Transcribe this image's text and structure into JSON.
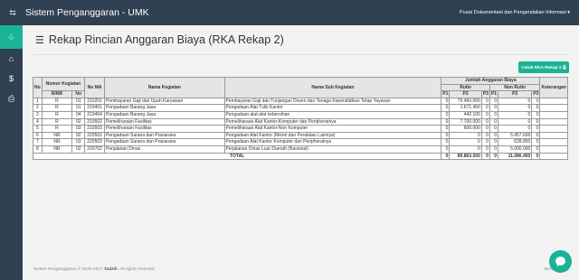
{
  "topbar": {
    "toggle_icon": "⇆",
    "brand": "Sistem Penganggaran - UMK",
    "user": "Pusat Dokumentasi dan Pengendalian Informasi ▾"
  },
  "sidebar": {
    "items": [
      {
        "icon": "palm-icon",
        "glyph": "♧",
        "active": true
      },
      {
        "icon": "home-icon",
        "glyph": "⌂",
        "active": false
      },
      {
        "icon": "dollar-icon",
        "glyph": "$",
        "active": false
      },
      {
        "icon": "print-icon",
        "glyph": "⎙",
        "active": false
      }
    ]
  },
  "page": {
    "title": "Rekap Rincian Anggaran Biaya (RKA Rekap 2)",
    "title_icon": "☰",
    "print_button": "Cetak RKA Rekap 2 ⎙"
  },
  "table": {
    "headers": {
      "no": "No",
      "nomor_kegiatan": "Nomor Kegiatan",
      "rnr": "R/NR",
      "no_sub": "No",
      "no_ma": "No MA",
      "nama_kegiatan": "Nama Kegiatan",
      "nama_sub": "Nama Sub Kegiatan",
      "jumlah": "Jumlah Anggaran Biaya",
      "rutin": "Rutin",
      "non_rutin": "Non Rutin",
      "p1": "P1",
      "p2": "P2",
      "p3": "P3",
      "np1": "P1",
      "np2": "P2",
      "np3": "P3",
      "keterangan": "Keterangan"
    },
    "rows": [
      {
        "no": "1",
        "rnr": "R",
        "sub": "01",
        "ma": "210201",
        "kegiatan": "Pembayaran Gaji dan Upah Karyawan",
        "sub_kegiatan": "Pembayaran Gaji dan Tunjangan Dosen dan Tenaga Kependidikan Tetap Yayasan",
        "p1": "0",
        "p2": "79.450.000",
        "p3": "0",
        "np1": "0",
        "np2": "0",
        "np3": "0",
        "ket": ""
      },
      {
        "no": "2",
        "rnr": "R",
        "sub": "01",
        "ma": "210401",
        "kegiatan": "Pengadaan Barang Jasa",
        "sub_kegiatan": "Pengadaan Alat Tulis Kantor",
        "p1": "0",
        "p2": "1.671.450",
        "p3": "0",
        "np1": "0",
        "np2": "0",
        "np3": "0",
        "ket": ""
      },
      {
        "no": "3",
        "rnr": "R",
        "sub": "04",
        "ma": "210404",
        "kegiatan": "Pengadaan Barang Jasa",
        "sub_kegiatan": "Pengadaan alat-alat kebersihan",
        "p1": "0",
        "p2": "442.100",
        "p3": "0",
        "np1": "0",
        "np2": "0",
        "np3": "0",
        "ket": ""
      },
      {
        "no": "4",
        "rnr": "R",
        "sub": "02",
        "ma": "210502",
        "kegiatan": "Pemeliharaan Fasilitas",
        "sub_kegiatan": "Pemeliharaan Alat Kantor-Komputer dan Peripheralnya",
        "p1": "0",
        "p2": "7.700.000",
        "p3": "0",
        "np1": "0",
        "np2": "0",
        "np3": "0",
        "ket": ""
      },
      {
        "no": "5",
        "rnr": "R",
        "sub": "03",
        "ma": "210503",
        "kegiatan": "Pemeliharaan Fasilitas",
        "sub_kegiatan": "Pemeliharaan Alat Kantor-Non Komputer",
        "p1": "0",
        "p2": "600.000",
        "p3": "0",
        "np1": "0",
        "np2": "0",
        "np3": "0",
        "ket": ""
      },
      {
        "no": "6",
        "rnr": "NR",
        "sub": "02",
        "ma": "220502",
        "kegiatan": "Pengadaan Sarana dan Prasarana",
        "sub_kegiatan": "Pengadaan Alat Kantor (Mesin dan Peralatan Lainnya)",
        "p1": "0",
        "p2": "0",
        "p3": "0",
        "np1": "0",
        "np2": "5.457.600",
        "np3": "0",
        "ket": ""
      },
      {
        "no": "7",
        "rnr": "NR",
        "sub": "03",
        "ma": "220503",
        "kegiatan": "Pengadaan Sarana dan Prasarana",
        "sub_kegiatan": "Pengadaan Alat Kantor Komputer dan Peripheralnya",
        "p1": "0",
        "p2": "0",
        "p3": "0",
        "np1": "0",
        "np2": "628.850",
        "np3": "0",
        "ket": ""
      },
      {
        "no": "8",
        "rnr": "NR",
        "sub": "02",
        "ma": "220702",
        "kegiatan": "Perjalanan Dinas",
        "sub_kegiatan": "Perjalanan Dinas Luar Daerah (Nasional)",
        "p1": "0",
        "p2": "0",
        "p3": "0",
        "np1": "0",
        "np2": "5.000.000",
        "np3": "0",
        "ket": ""
      }
    ],
    "total": {
      "label": "TOTAL",
      "p1": "0",
      "p2": "89.863.550",
      "p3": "0",
      "np1": "0",
      "np2": "11.086.450",
      "np3": "0",
      "ket": ""
    }
  },
  "footer": {
    "left_prefix": "Sistem Penganggaran © 2015-2017 ",
    "left_brand": "Tadzih",
    "left_suffix": ". All rights reserved.",
    "right": "Version"
  },
  "chat": {
    "icon": "chat-icon"
  }
}
